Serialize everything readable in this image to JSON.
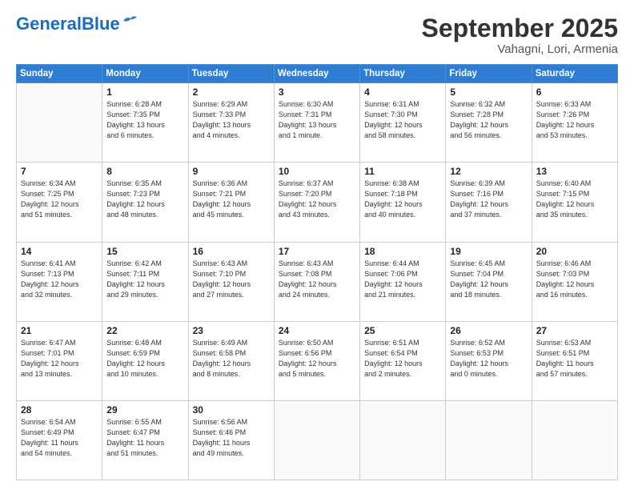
{
  "header": {
    "logo_general": "General",
    "logo_blue": "Blue",
    "month_title": "September 2025",
    "location": "Vahagni, Lori, Armenia"
  },
  "days_of_week": [
    "Sunday",
    "Monday",
    "Tuesday",
    "Wednesday",
    "Thursday",
    "Friday",
    "Saturday"
  ],
  "weeks": [
    [
      {
        "day": "",
        "info": ""
      },
      {
        "day": "1",
        "info": "Sunrise: 6:28 AM\nSunset: 7:35 PM\nDaylight: 13 hours\nand 6 minutes."
      },
      {
        "day": "2",
        "info": "Sunrise: 6:29 AM\nSunset: 7:33 PM\nDaylight: 13 hours\nand 4 minutes."
      },
      {
        "day": "3",
        "info": "Sunrise: 6:30 AM\nSunset: 7:31 PM\nDaylight: 13 hours\nand 1 minute."
      },
      {
        "day": "4",
        "info": "Sunrise: 6:31 AM\nSunset: 7:30 PM\nDaylight: 12 hours\nand 58 minutes."
      },
      {
        "day": "5",
        "info": "Sunrise: 6:32 AM\nSunset: 7:28 PM\nDaylight: 12 hours\nand 56 minutes."
      },
      {
        "day": "6",
        "info": "Sunrise: 6:33 AM\nSunset: 7:26 PM\nDaylight: 12 hours\nand 53 minutes."
      }
    ],
    [
      {
        "day": "7",
        "info": "Sunrise: 6:34 AM\nSunset: 7:25 PM\nDaylight: 12 hours\nand 51 minutes."
      },
      {
        "day": "8",
        "info": "Sunrise: 6:35 AM\nSunset: 7:23 PM\nDaylight: 12 hours\nand 48 minutes."
      },
      {
        "day": "9",
        "info": "Sunrise: 6:36 AM\nSunset: 7:21 PM\nDaylight: 12 hours\nand 45 minutes."
      },
      {
        "day": "10",
        "info": "Sunrise: 6:37 AM\nSunset: 7:20 PM\nDaylight: 12 hours\nand 43 minutes."
      },
      {
        "day": "11",
        "info": "Sunrise: 6:38 AM\nSunset: 7:18 PM\nDaylight: 12 hours\nand 40 minutes."
      },
      {
        "day": "12",
        "info": "Sunrise: 6:39 AM\nSunset: 7:16 PM\nDaylight: 12 hours\nand 37 minutes."
      },
      {
        "day": "13",
        "info": "Sunrise: 6:40 AM\nSunset: 7:15 PM\nDaylight: 12 hours\nand 35 minutes."
      }
    ],
    [
      {
        "day": "14",
        "info": "Sunrise: 6:41 AM\nSunset: 7:13 PM\nDaylight: 12 hours\nand 32 minutes."
      },
      {
        "day": "15",
        "info": "Sunrise: 6:42 AM\nSunset: 7:11 PM\nDaylight: 12 hours\nand 29 minutes."
      },
      {
        "day": "16",
        "info": "Sunrise: 6:43 AM\nSunset: 7:10 PM\nDaylight: 12 hours\nand 27 minutes."
      },
      {
        "day": "17",
        "info": "Sunrise: 6:43 AM\nSunset: 7:08 PM\nDaylight: 12 hours\nand 24 minutes."
      },
      {
        "day": "18",
        "info": "Sunrise: 6:44 AM\nSunset: 7:06 PM\nDaylight: 12 hours\nand 21 minutes."
      },
      {
        "day": "19",
        "info": "Sunrise: 6:45 AM\nSunset: 7:04 PM\nDaylight: 12 hours\nand 18 minutes."
      },
      {
        "day": "20",
        "info": "Sunrise: 6:46 AM\nSunset: 7:03 PM\nDaylight: 12 hours\nand 16 minutes."
      }
    ],
    [
      {
        "day": "21",
        "info": "Sunrise: 6:47 AM\nSunset: 7:01 PM\nDaylight: 12 hours\nand 13 minutes."
      },
      {
        "day": "22",
        "info": "Sunrise: 6:48 AM\nSunset: 6:59 PM\nDaylight: 12 hours\nand 10 minutes."
      },
      {
        "day": "23",
        "info": "Sunrise: 6:49 AM\nSunset: 6:58 PM\nDaylight: 12 hours\nand 8 minutes."
      },
      {
        "day": "24",
        "info": "Sunrise: 6:50 AM\nSunset: 6:56 PM\nDaylight: 12 hours\nand 5 minutes."
      },
      {
        "day": "25",
        "info": "Sunrise: 6:51 AM\nSunset: 6:54 PM\nDaylight: 12 hours\nand 2 minutes."
      },
      {
        "day": "26",
        "info": "Sunrise: 6:52 AM\nSunset: 6:53 PM\nDaylight: 12 hours\nand 0 minutes."
      },
      {
        "day": "27",
        "info": "Sunrise: 6:53 AM\nSunset: 6:51 PM\nDaylight: 11 hours\nand 57 minutes."
      }
    ],
    [
      {
        "day": "28",
        "info": "Sunrise: 6:54 AM\nSunset: 6:49 PM\nDaylight: 11 hours\nand 54 minutes."
      },
      {
        "day": "29",
        "info": "Sunrise: 6:55 AM\nSunset: 6:47 PM\nDaylight: 11 hours\nand 51 minutes."
      },
      {
        "day": "30",
        "info": "Sunrise: 6:56 AM\nSunset: 6:46 PM\nDaylight: 11 hours\nand 49 minutes."
      },
      {
        "day": "",
        "info": ""
      },
      {
        "day": "",
        "info": ""
      },
      {
        "day": "",
        "info": ""
      },
      {
        "day": "",
        "info": ""
      }
    ]
  ]
}
